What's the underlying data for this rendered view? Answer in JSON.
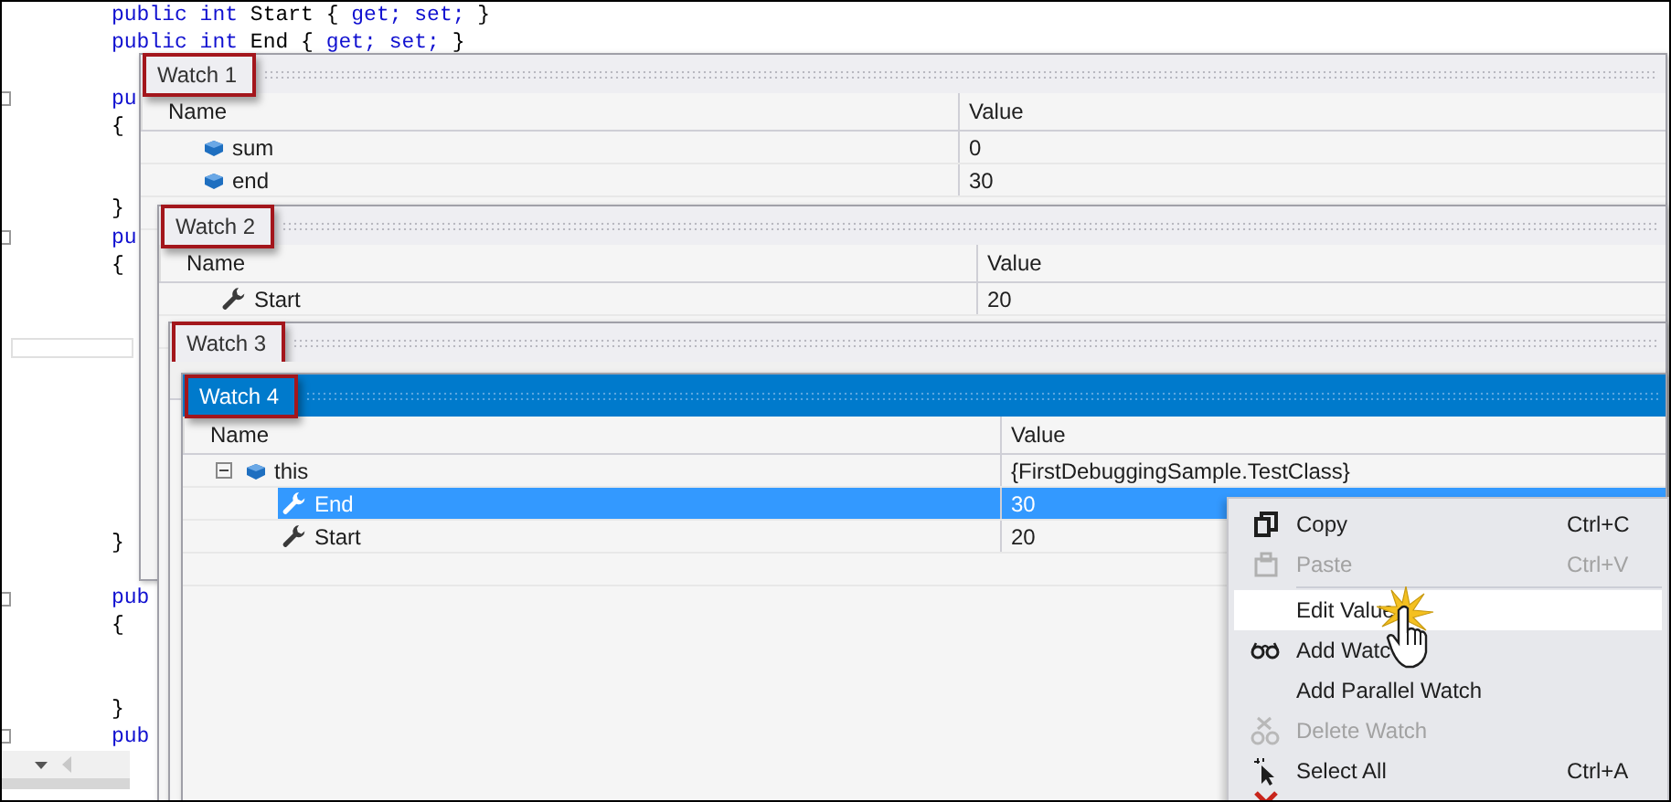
{
  "editor": {
    "lines": [
      {
        "collapsible": false,
        "tokens": [
          {
            "kind": "keyword",
            "text": "public int"
          },
          {
            "kind": "plain",
            "text": " Start { "
          },
          {
            "kind": "keyword",
            "text": "get; set;"
          },
          {
            "kind": "plain",
            "text": " }"
          }
        ]
      },
      {
        "collapsible": false,
        "tokens": [
          {
            "kind": "keyword",
            "text": "public int"
          },
          {
            "kind": "plain",
            "text": " End { "
          },
          {
            "kind": "keyword",
            "text": "get; set;"
          },
          {
            "kind": "plain",
            "text": " }"
          }
        ]
      },
      {
        "collapsible": true,
        "tokens": [
          {
            "kind": "keyword",
            "text": "pu"
          }
        ]
      },
      {
        "collapsible": false,
        "tokens": [
          {
            "kind": "plain",
            "text": "{"
          }
        ]
      },
      {
        "collapsible": false,
        "tokens": [
          {
            "kind": "plain",
            "text": "}"
          }
        ]
      },
      {
        "collapsible": true,
        "tokens": [
          {
            "kind": "keyword",
            "text": "pu"
          }
        ]
      },
      {
        "collapsible": false,
        "tokens": [
          {
            "kind": "plain",
            "text": "{"
          }
        ]
      },
      {
        "collapsible": false,
        "tokens": [
          {
            "kind": "plain",
            "text": "}"
          }
        ]
      },
      {
        "collapsible": true,
        "tokens": [
          {
            "kind": "keyword",
            "text": "pub"
          }
        ]
      },
      {
        "collapsible": false,
        "tokens": [
          {
            "kind": "plain",
            "text": "{"
          }
        ]
      },
      {
        "collapsible": false,
        "tokens": [
          {
            "kind": "plain",
            "text": "}"
          }
        ]
      },
      {
        "collapsible": true,
        "tokens": [
          {
            "kind": "keyword",
            "text": "pub"
          }
        ]
      }
    ]
  },
  "watches": [
    {
      "title": "Watch 1",
      "active": false,
      "columns": [
        "Name",
        "Value"
      ],
      "rows": [
        {
          "kind": "variable",
          "name": "sum",
          "value": "0",
          "selected": false
        },
        {
          "kind": "variable",
          "name": "end",
          "value": "30",
          "selected": false
        }
      ]
    },
    {
      "title": "Watch 2",
      "active": false,
      "columns": [
        "Name",
        "Value"
      ],
      "rows": [
        {
          "kind": "property",
          "name": "Start",
          "value": "20",
          "selected": false
        }
      ]
    },
    {
      "title": "Watch 3",
      "active": false
    },
    {
      "title": "Watch 4",
      "active": true,
      "columns": [
        "Name",
        "Value"
      ],
      "rows": [
        {
          "kind": "variable",
          "name": "this",
          "value": "{FirstDebuggingSample.TestClass}",
          "selected": false,
          "expanded": true,
          "children": [
            {
              "kind": "property",
              "name": "End",
              "value": "30",
              "selected": true
            },
            {
              "kind": "property",
              "name": "Start",
              "value": "20",
              "selected": false
            }
          ]
        }
      ]
    }
  ],
  "context_menu": {
    "items": [
      {
        "kind": "copy",
        "label": "Copy",
        "shortcut": "Ctrl+C",
        "disabled": false,
        "highlighted": false
      },
      {
        "kind": "paste",
        "label": "Paste",
        "shortcut": "Ctrl+V",
        "disabled": true,
        "highlighted": false
      },
      {
        "kind": "separator"
      },
      {
        "kind": "edit",
        "label": "Edit Value",
        "disabled": false,
        "highlighted": true
      },
      {
        "kind": "watch",
        "label": "Add Watc",
        "disabled": false,
        "highlighted": false
      },
      {
        "kind": "parallel-watch",
        "label": "Add Parallel Watch",
        "disabled": false,
        "highlighted": false
      },
      {
        "kind": "delete",
        "label": "Delete Watch",
        "disabled": true,
        "highlighted": false
      },
      {
        "kind": "select-all",
        "label": "Select All",
        "shortcut": "Ctrl+A",
        "disabled": false,
        "highlighted": false
      },
      {
        "kind": "remove"
      }
    ]
  }
}
